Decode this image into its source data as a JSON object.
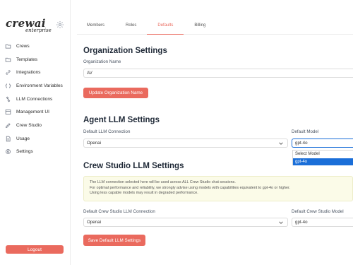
{
  "sidebar": {
    "logo_top": "crewai",
    "logo_bottom": "enterprise",
    "items": [
      {
        "label": "Crews",
        "icon": "folder-icon"
      },
      {
        "label": "Templates",
        "icon": "folder-icon"
      },
      {
        "label": "Integrations",
        "icon": "link-icon"
      },
      {
        "label": "Environment Variables",
        "icon": "code-icon"
      },
      {
        "label": "LLM Connections",
        "icon": "plug-icon"
      },
      {
        "label": "Management UI",
        "icon": "grid-icon"
      },
      {
        "label": "Crew Studio",
        "icon": "pencil-icon"
      },
      {
        "label": "Usage",
        "icon": "file-icon"
      },
      {
        "label": "Settings",
        "icon": "gear-icon"
      }
    ],
    "logout_label": "Logout"
  },
  "tabs": [
    {
      "label": "Members",
      "active": false
    },
    {
      "label": "Roles",
      "active": false
    },
    {
      "label": "Defaults",
      "active": true
    },
    {
      "label": "Billing",
      "active": false
    }
  ],
  "org": {
    "title": "Organization Settings",
    "name_label": "Organization Name",
    "name_value": "AV",
    "update_button": "Update Organization Name"
  },
  "agent_llm": {
    "title": "Agent LLM Settings",
    "connection_label": "Default LLM Connection",
    "connection_value": "Openai",
    "model_label": "Default Model",
    "model_value": "gpt-4o",
    "dropdown_options": [
      {
        "label": "Select Model",
        "selected": false
      },
      {
        "label": "gpt-4o",
        "selected": true
      }
    ]
  },
  "studio_llm": {
    "title": "Crew Studio LLM Settings",
    "notice_lines": [
      "The LLM connection selected here will be used across ALL Crew Studio chat sessions.",
      "For optimal performance and reliability, we strongly advise using models with capabilities equivalent to gpt-4o or higher.",
      "Using less capable models may result in degraded performance."
    ],
    "connection_label": "Default Crew Studio LLM Connection",
    "connection_value": "Openai",
    "model_label": "Default Crew Studio Model",
    "model_value": "gpt-4o",
    "save_button": "Save Default LLM Settings"
  },
  "colors": {
    "accent": "#ea6a5e",
    "dropdown_highlight": "#1a6ed8",
    "notice_bg": "#fbfbe8"
  }
}
